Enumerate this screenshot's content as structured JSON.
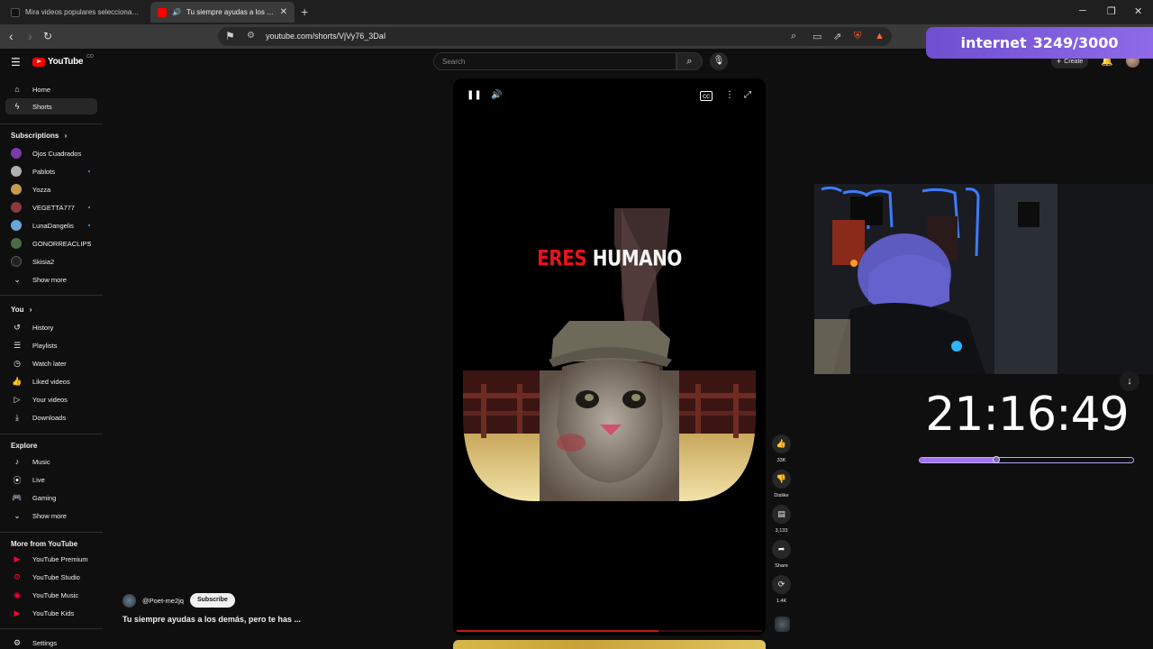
{
  "browser": {
    "tabs": [
      {
        "title": "Mira videos populares seleccionados",
        "active": false
      },
      {
        "title": "Tu siempre ayudas a los demás",
        "active": true
      }
    ],
    "url": "youtube.com/shorts/VjVy76_3DaI"
  },
  "overlay": {
    "label": "internet",
    "count": "3249/3000",
    "clock": "21:16:49",
    "progress_fraction": 0.36
  },
  "header": {
    "logo": "YouTube",
    "logo_country": "CO",
    "search_placeholder": "Search",
    "create_label": "Create"
  },
  "sidebar": {
    "main": [
      {
        "label": "Home",
        "icon": "home-icon"
      },
      {
        "label": "Shorts",
        "icon": "shorts-icon",
        "active": true
      }
    ],
    "subscriptions_heading": "Subscriptions",
    "subscriptions": [
      {
        "label": "Ojos Cuadrados",
        "color": "#7a3aa8",
        "dot": false
      },
      {
        "label": "Pablots",
        "color": "#b0b0b0",
        "dot": true
      },
      {
        "label": "Yozza",
        "color": "#c89a4a",
        "dot": false
      },
      {
        "label": "VEGETTA777",
        "color": "#8a3a3a",
        "dot": true
      },
      {
        "label": "LunaDangelis",
        "color": "#6aa6d6",
        "dot": true
      },
      {
        "label": "GONORREACLIPS",
        "color": "#4a6a4a",
        "dot": true
      },
      {
        "label": "Skisia2",
        "color": "#222222",
        "dot": false
      }
    ],
    "subscriptions_more": "Show more",
    "you_heading": "You",
    "you": [
      {
        "label": "History",
        "icon": "history-icon"
      },
      {
        "label": "Playlists",
        "icon": "playlists-icon"
      },
      {
        "label": "Watch later",
        "icon": "watch-later-icon"
      },
      {
        "label": "Liked videos",
        "icon": "like-icon"
      },
      {
        "label": "Your videos",
        "icon": "your-videos-icon"
      },
      {
        "label": "Downloads",
        "icon": "download-icon"
      }
    ],
    "explore_heading": "Explore",
    "explore": [
      {
        "label": "Music",
        "icon": "music-icon"
      },
      {
        "label": "Live",
        "icon": "live-icon"
      },
      {
        "label": "Gaming",
        "icon": "gaming-icon"
      }
    ],
    "explore_more": "Show more",
    "more_heading": "More from YouTube",
    "more": [
      {
        "label": "YouTube Premium"
      },
      {
        "label": "YouTube Studio"
      },
      {
        "label": "YouTube Music"
      },
      {
        "label": "YouTube Kids"
      }
    ],
    "settings": "Settings"
  },
  "short": {
    "caption_red": "ERES",
    "caption_white": "HUMANO",
    "channel": "@Poet-me2jq",
    "subscribe": "Subscribe",
    "title": "Tu siempre ayudas a los demás, pero te has ...",
    "progress_fraction": 0.66,
    "actions": {
      "likes": "33K",
      "dislike": "Dislike",
      "comments": "3,133",
      "share": "Share",
      "remix": "1.4K"
    }
  }
}
